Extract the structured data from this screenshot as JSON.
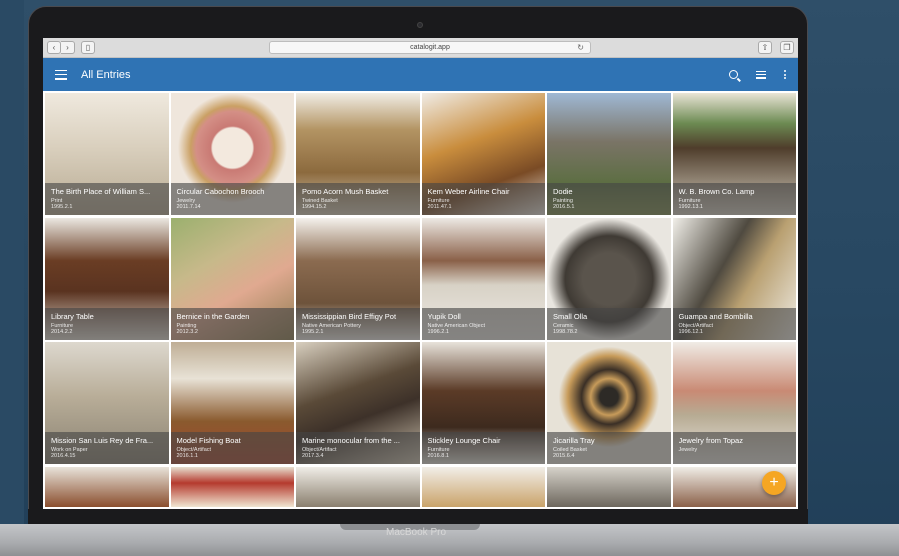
{
  "browser": {
    "url": "catalogit.app",
    "back_icon": "chevron-left-icon",
    "forward_icon": "chevron-right-icon",
    "sidebar_icon": "sidebar-icon",
    "reload_icon": "reload-icon",
    "share_icon": "share-icon",
    "tabs_icon": "tabs-icon"
  },
  "appbar": {
    "title": "All Entries",
    "color": "#2f73b4",
    "menu_icon": "hamburger-icon",
    "search_icon": "search-icon",
    "view_icon": "list-view-icon",
    "more_icon": "more-vert-icon"
  },
  "device_label": "MacBook Pro",
  "fab": {
    "label": "+",
    "color": "#f5a623"
  },
  "entries": [
    {
      "title": "The Birth Place of William S...",
      "type": "Print",
      "number": "1995.2.1"
    },
    {
      "title": "Circular Cabochon Brooch",
      "type": "Jewelry",
      "number": "2011.7.14"
    },
    {
      "title": "Pomo Acorn Mush Basket",
      "type": "Twined Basket",
      "number": "1994.15.2"
    },
    {
      "title": "Kem Weber Airline Chair",
      "type": "Furniture",
      "number": "2011.47.1"
    },
    {
      "title": "Dodie",
      "type": "Painting",
      "number": "2016.5.1"
    },
    {
      "title": "W. B. Brown Co. Lamp",
      "type": "Furniture",
      "number": "1992.13.1"
    },
    {
      "title": "Library Table",
      "type": "Furniture",
      "number": "2014.2.2"
    },
    {
      "title": "Bernice in the Garden",
      "type": "Painting",
      "number": "2012.3.2"
    },
    {
      "title": "Mississippian Bird Effigy Pot",
      "type": "Native American Pottery",
      "number": "1995.2.1"
    },
    {
      "title": "Yupik Doll",
      "type": "Native American Object",
      "number": "1996.2.1"
    },
    {
      "title": "Small Olla",
      "type": "Ceramic",
      "number": "1998.78.2"
    },
    {
      "title": "Guampa and Bombilla",
      "type": "Object/Artifact",
      "number": "1996.12.1"
    },
    {
      "title": "Mission San Luis Rey de Fra...",
      "type": "Work on Paper",
      "number": "2016.4.15"
    },
    {
      "title": "Model Fishing Boat",
      "type": "Object/Artifact",
      "number": "2016.1.1"
    },
    {
      "title": "Marine monocular from the ...",
      "type": "Object/Artifact",
      "number": "2017.3.4"
    },
    {
      "title": "Stickley Lounge Chair",
      "type": "Furniture",
      "number": "2016.8.1"
    },
    {
      "title": "Jicarilla Tray",
      "type": "Coiled Basket",
      "number": "2015.6.4"
    },
    {
      "title": "Jewelry from Topaz",
      "type": "Jewelry",
      "number": ""
    }
  ]
}
